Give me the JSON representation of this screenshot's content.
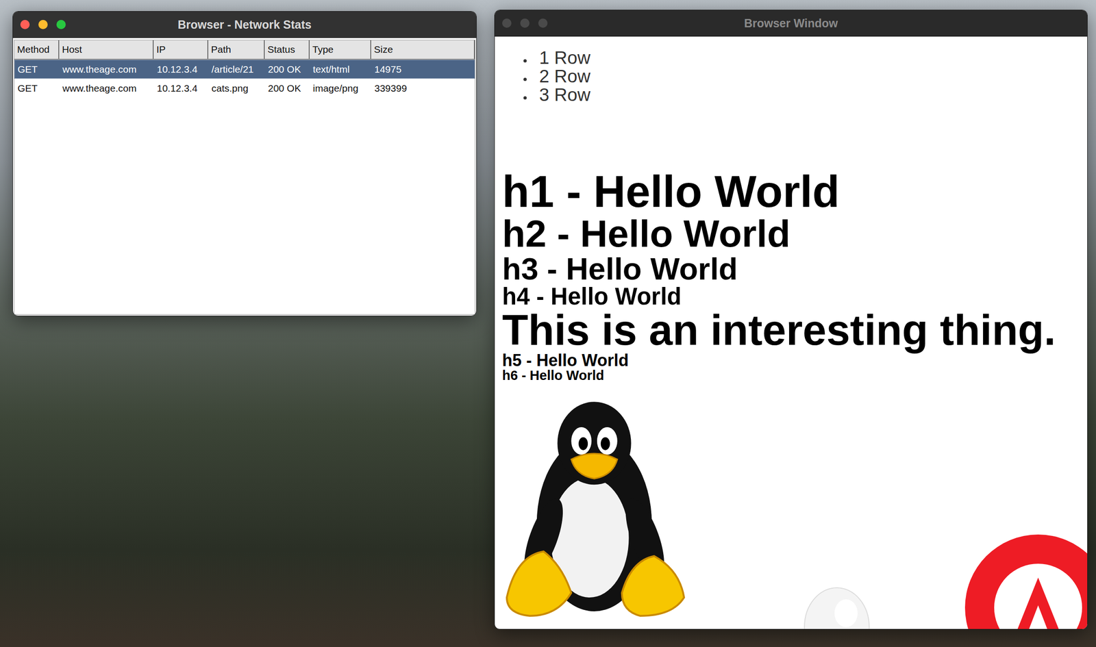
{
  "network_window": {
    "title": "Browser - Network Stats",
    "active": true,
    "columns": [
      "Method",
      "Host",
      "IP",
      "Path",
      "Status",
      "Type",
      "Size"
    ],
    "rows": [
      {
        "cells": [
          "GET",
          "www.theage.com",
          "10.12.3.4",
          "/article/21",
          "200 OK",
          "text/html",
          "14975"
        ],
        "selected": true
      },
      {
        "cells": [
          "GET",
          "www.theage.com",
          "10.12.3.4",
          "cats.png",
          "200 OK",
          "image/png",
          "339399"
        ],
        "selected": false
      }
    ]
  },
  "browser_window": {
    "title": "Browser Window",
    "active": false,
    "list": [
      "1 Row",
      "2 Row",
      "3 Row"
    ],
    "blocks": [
      {
        "kind": "heading",
        "level": 1,
        "text": "h1 - Hello World"
      },
      {
        "kind": "heading",
        "level": 2,
        "text": "h2 - Hello World"
      },
      {
        "kind": "heading",
        "level": 3,
        "text": "h3 - Hello World"
      },
      {
        "kind": "heading",
        "level": 4,
        "text": "h4 - Hello World"
      },
      {
        "kind": "text",
        "level": 0,
        "text": "This is an interesting thing."
      },
      {
        "kind": "heading",
        "level": 5,
        "text": "h5 - Hello World"
      },
      {
        "kind": "heading",
        "level": 6,
        "text": "h6 - Hello World"
      }
    ]
  }
}
